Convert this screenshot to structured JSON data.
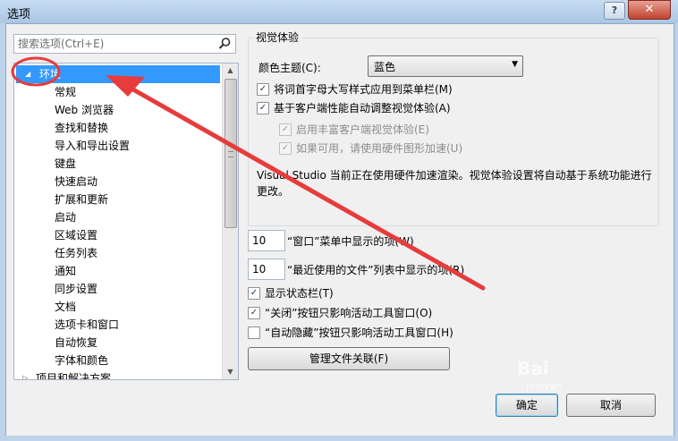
{
  "window": {
    "title": "选项",
    "help_label": "?",
    "close_label": "✕"
  },
  "search": {
    "placeholder": "搜索选项(Ctrl+E)"
  },
  "tree": {
    "root_label": "环境",
    "children": [
      "常规",
      "Web 浏览器",
      "查找和替换",
      "导入和导出设置",
      "键盘",
      "快速启动",
      "扩展和更新",
      "启动",
      "区域设置",
      "任务列表",
      "通知",
      "同步设置",
      "文档",
      "选项卡和窗口",
      "自动恢复",
      "字体和颜色"
    ],
    "next_root_label": "项目和解决方案"
  },
  "visual": {
    "group_title": "视觉体验",
    "theme_label": "颜色主题(C):",
    "theme_value": "蓝色",
    "cb_uppercase": "将词首字母大写样式应用到菜单栏(M)",
    "cb_auto_adjust": "基于客户端性能自动调整视觉体验(A)",
    "cb_rich_client": "启用丰富客户端视觉体验(E)",
    "cb_hardware": "如果可用，请使用硬件图形加速(U)",
    "description": "Visual Studio 当前正在使用硬件加速渲染。视觉体验设置将自动基于系统功能进行更改。",
    "check_mark": "✓"
  },
  "window_menu": {
    "count": "10",
    "label": "“窗口”菜单中显示的项(W)"
  },
  "recent_files": {
    "count": "10",
    "label": "“最近使用的文件”列表中显示的项(R)"
  },
  "options": {
    "statusbar": "显示状态栏(T)",
    "close_button": "“关闭”按钮只影响活动工具窗口(O)",
    "autohide_button": "“自动隐藏”按钮只影响活动工具窗口(H)",
    "statusbar_checked": true,
    "close_checked": true,
    "autohide_checked": false
  },
  "buttons": {
    "file_assoc": "管理文件关联(F)",
    "ok": "确定",
    "cancel": "取消"
  },
  "watermark": {
    "text": "Bai",
    "sub": "jingyan"
  },
  "colors": {
    "selection": "#3399ff",
    "annotation_red": "#e63c3c",
    "client_bg": "#f0f0f0"
  }
}
